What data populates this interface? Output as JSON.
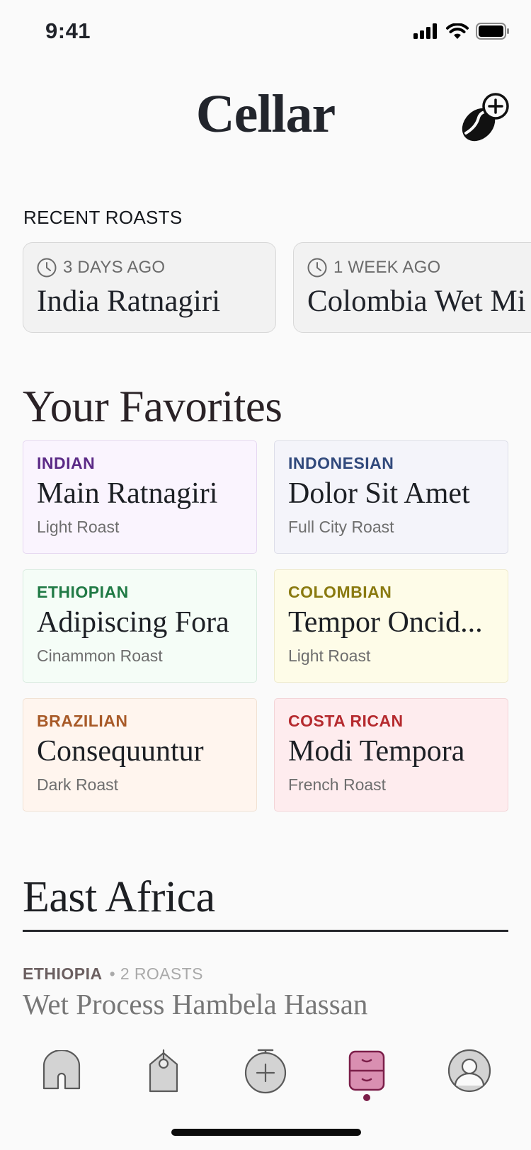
{
  "status_bar": {
    "time": "9:41",
    "icons": [
      "cellular-signal-icon",
      "wifi-icon",
      "battery-icon"
    ]
  },
  "header": {
    "title": "Cellar",
    "add_icon": "coffee-bean-add-icon"
  },
  "recent": {
    "label": "RECENT ROASTS",
    "items": [
      {
        "when": "3 DAYS AGO",
        "name": "India Ratnagiri"
      },
      {
        "when": "1 WEEK AGO",
        "name": "Colombia Wet Mi"
      }
    ]
  },
  "favorites": {
    "heading": "Your Favorites",
    "items": [
      {
        "origin": "INDIAN",
        "name": "Main Ratnagiri",
        "roast": "Light Roast",
        "accent": "#5b2a86",
        "bg": "#faf4fe",
        "border": "#e6d8f1"
      },
      {
        "origin": "INDONESIAN",
        "name": "Dolor Sit Amet",
        "roast": "Full City Roast",
        "accent": "#31497c",
        "bg": "#f4f4fa",
        "border": "#dcdde8"
      },
      {
        "origin": "ETHIOPIAN",
        "name": "Adipiscing Fora",
        "roast": "Cinammon Roast",
        "accent": "#207a45",
        "bg": "#f5fdf7",
        "border": "#d9ece0"
      },
      {
        "origin": "COLOMBIAN",
        "name": "Tempor Oncid...",
        "roast": "Light Roast",
        "accent": "#8a7a10",
        "bg": "#fefce8",
        "border": "#eeeacb"
      },
      {
        "origin": "BRAZILIAN",
        "name": "Consequuntur",
        "roast": "Dark Roast",
        "accent": "#a85a28",
        "bg": "#fff5ee",
        "border": "#f1e1d3"
      },
      {
        "origin": "COSTA RICAN",
        "name": "Modi Tempora",
        "roast": "French Roast",
        "accent": "#b52a2e",
        "bg": "#feecee",
        "border": "#f3d4d7"
      }
    ]
  },
  "region": {
    "heading": "East Africa",
    "country": "ETHIOPIA",
    "count": "• 2 ROASTS",
    "coffee": "Wet Process Hambela Hassan"
  },
  "tab_bar": {
    "tabs": [
      "home-icon",
      "tag-icon",
      "add-roast-icon",
      "cellar-cabinet-icon",
      "profile-icon"
    ],
    "active_index": 3,
    "active_color": "#7b1e49"
  }
}
